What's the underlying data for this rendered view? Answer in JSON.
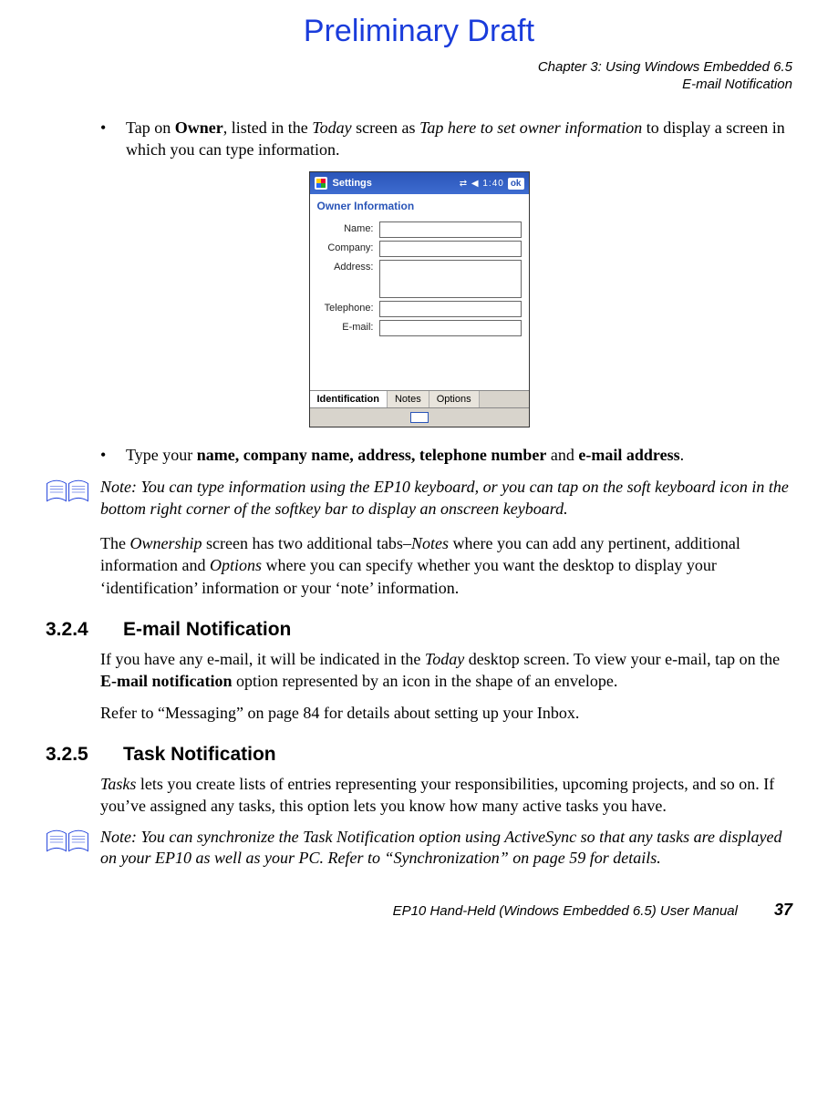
{
  "watermark": "Preliminary Draft",
  "header": {
    "chapter": "Chapter 3: Using Windows Embedded 6.5",
    "section": "E-mail Notification"
  },
  "bullets": {
    "b1_pre": "Tap on ",
    "b1_bold1": "Owner",
    "b1_mid1": ", listed in the ",
    "b1_ital1": "Today",
    "b1_mid2": " screen as ",
    "b1_ital2": "Tap here to set owner information",
    "b1_post": " to display a screen in which you can type information.",
    "b2_pre": "Type your ",
    "b2_bold": "name, company name, address, telephone number",
    "b2_mid": " and ",
    "b2_bold2": "e-mail address",
    "b2_post": "."
  },
  "pda": {
    "titlebar": "Settings",
    "time": "1:40",
    "ok": "ok",
    "subtitle": "Owner Information",
    "labels": {
      "name": "Name:",
      "company": "Company:",
      "address": "Address:",
      "telephone": "Telephone:",
      "email": "E-mail:"
    },
    "tabs": {
      "id": "Identification",
      "notes": "Notes",
      "options": "Options"
    }
  },
  "note1": {
    "label": "Note:",
    "text": " You can type information using the EP10 keyboard, or you can tap on the soft keyboard icon in the bottom right corner of the softkey bar to display an onscreen keyboard."
  },
  "para1": {
    "pre": "The ",
    "i1": "Ownership",
    "mid1": " screen has two additional tabs–",
    "i2": "Notes",
    "mid2": " where you can add any pertinent, additional information and ",
    "i3": "Options",
    "post": " where you can specify whether you want the desktop to display your ‘identification’ information or your ‘note’ information."
  },
  "sec324": {
    "num": "3.2.4",
    "title": "E-mail Notification",
    "p1_pre": "If you have any e-mail, it will be indicated in the ",
    "p1_i1": "Today",
    "p1_mid": " desktop screen. To view your e-mail, tap on the ",
    "p1_b1": "E-mail notification",
    "p1_post": " option represented by an icon in the shape of an envelope.",
    "p2": "Refer to “Messaging” on page 84 for details about setting up your Inbox."
  },
  "sec325": {
    "num": "3.2.5",
    "title": "Task Notification",
    "p1_i1": "Tasks",
    "p1_post": " lets you create lists of entries representing your responsibilities, upcoming projects, and so on. If you’ve assigned any tasks, this option lets you know how many active tasks you have."
  },
  "note2": {
    "label": "Note:",
    "text": " You can synchronize the Task Notification option using ActiveSync so that any tasks are displayed on your EP10 as well as your PC. Refer to “Synchronization” on page 59 for details."
  },
  "footer": {
    "manual": "EP10 Hand-Held (Windows Embedded 6.5) User Manual",
    "page": "37"
  }
}
